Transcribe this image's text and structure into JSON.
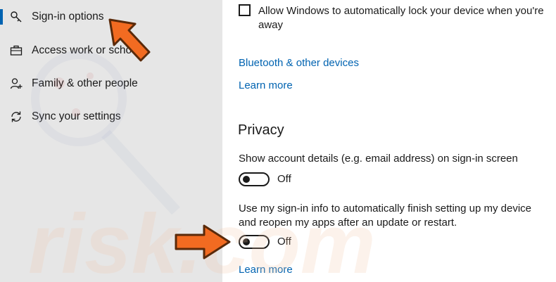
{
  "sidebar": {
    "items": [
      {
        "label": "Sign-in options",
        "icon": "key-icon",
        "selected": true
      },
      {
        "label": "Access work or school",
        "icon": "briefcase-icon",
        "selected": false
      },
      {
        "label": "Family & other people",
        "icon": "person-add-icon",
        "selected": false
      },
      {
        "label": "Sync your settings",
        "icon": "sync-icon",
        "selected": false
      }
    ]
  },
  "main": {
    "lock_checkbox_label": "Allow Windows to automatically lock your device when you're away",
    "lock_checkbox_checked": false,
    "bluetooth_link": "Bluetooth & other devices",
    "learn_more_1": "Learn more",
    "privacy": {
      "title": "Privacy",
      "setting1_label": "Show account details (e.g. email address) on sign-in screen",
      "setting1_state": "Off",
      "setting2_label": "Use my sign-in info to automatically finish setting up my device and reopen my apps after an update or restart.",
      "setting2_state": "Off"
    },
    "learn_more_2": "Learn more"
  },
  "colors": {
    "accent": "#0063b1",
    "sidebar_bg": "#e6e6e6",
    "annotation_arrow": "#f26b21"
  },
  "watermark": {
    "text": "risk.com"
  }
}
